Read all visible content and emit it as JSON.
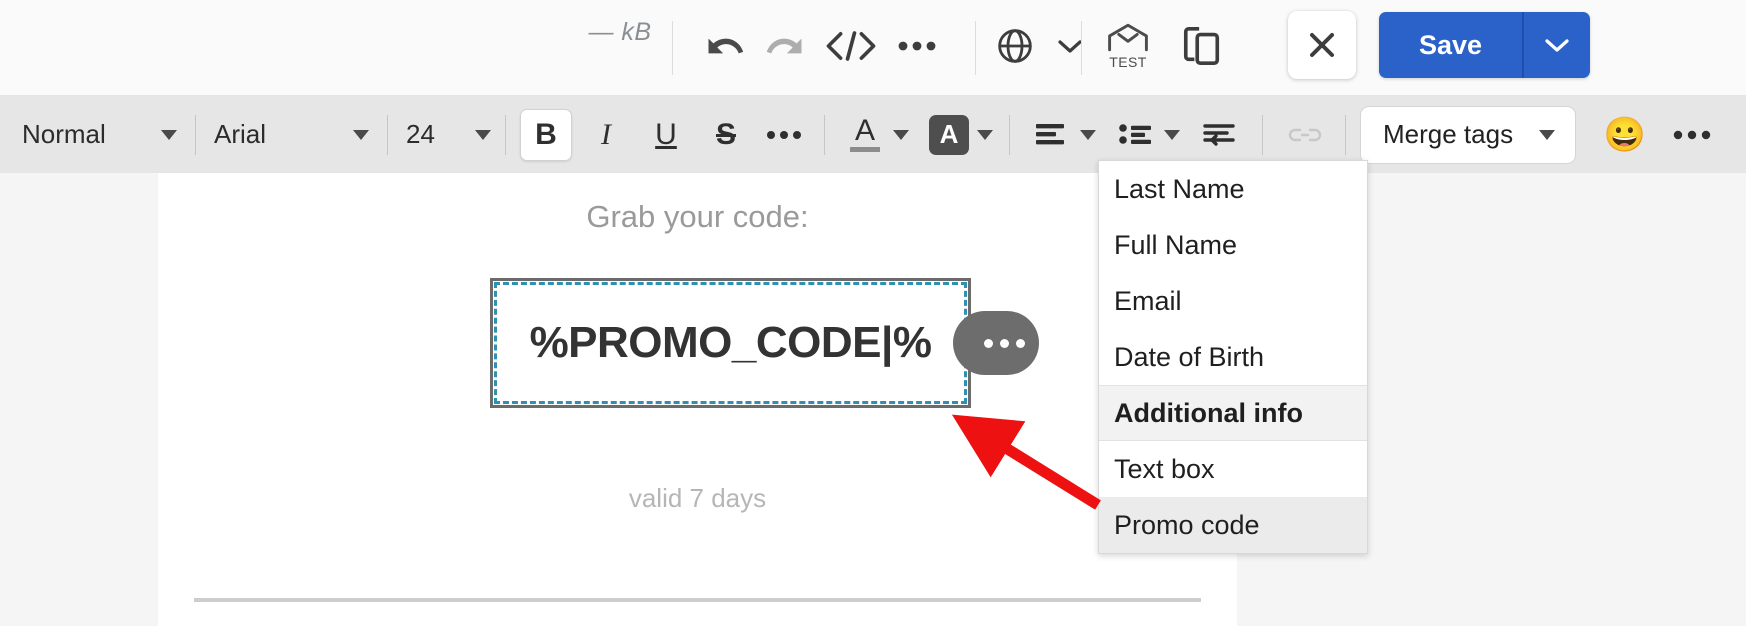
{
  "topbar": {
    "file_size": "— kB",
    "actions": [
      {
        "name": "undo-icon",
        "label": "Undo"
      },
      {
        "name": "redo-icon",
        "label": "Redo"
      },
      {
        "name": "code-icon",
        "label": "Source code"
      },
      {
        "name": "more-options-icon",
        "label": "More"
      },
      {
        "name": "language-globe-icon",
        "label": "Language"
      },
      {
        "name": "test-email-icon",
        "label": "Send test"
      },
      {
        "name": "preview-devices-icon",
        "label": "Preview"
      }
    ],
    "test_label": "TEST",
    "close_label": "Close",
    "save_label": "Save",
    "save_caret_label": "Save options",
    "accent_color": "#2a62c9",
    "bar_bg": "#fafafa"
  },
  "formatbar": {
    "paragraph_style": "Normal",
    "font_family": "Arial",
    "font_size": "24",
    "bold_label": "B",
    "italic_label": "I",
    "underline_label": "U",
    "strike_label": "S",
    "more_text_label": "•••",
    "text_color_label": "A",
    "highlight_color_label": "A",
    "align_label": "Align",
    "list_label": "List",
    "indent_label": "Indent",
    "link_label": "Link",
    "merge_tags_label": "Merge tags",
    "emoji_label": "😀",
    "overflow_label": "•••",
    "bar_bg": "#e6e6e6",
    "bold_active": true,
    "link_disabled": true
  },
  "merge_menu": {
    "items": [
      {
        "label": "Last Name",
        "type": "item",
        "state": "normal"
      },
      {
        "label": "Full Name",
        "type": "item",
        "state": "normal"
      },
      {
        "label": "Email",
        "type": "item",
        "state": "normal"
      },
      {
        "label": "Date of Birth",
        "type": "item",
        "state": "normal"
      },
      {
        "label": "Additional info",
        "type": "section",
        "state": "header"
      },
      {
        "label": "Text box",
        "type": "item",
        "state": "normal"
      },
      {
        "label": "Promo code",
        "type": "item",
        "state": "hover"
      }
    ]
  },
  "canvas": {
    "heading": "Grab your code:",
    "promo_placeholder": "%PROMO_CODE|%",
    "footnote": "valid 7 days",
    "selection_border_color": "#2f8fb5",
    "handle_label": "•••"
  },
  "annotation": {
    "arrow_color": "#ee1111",
    "points_to": "Promo code"
  }
}
